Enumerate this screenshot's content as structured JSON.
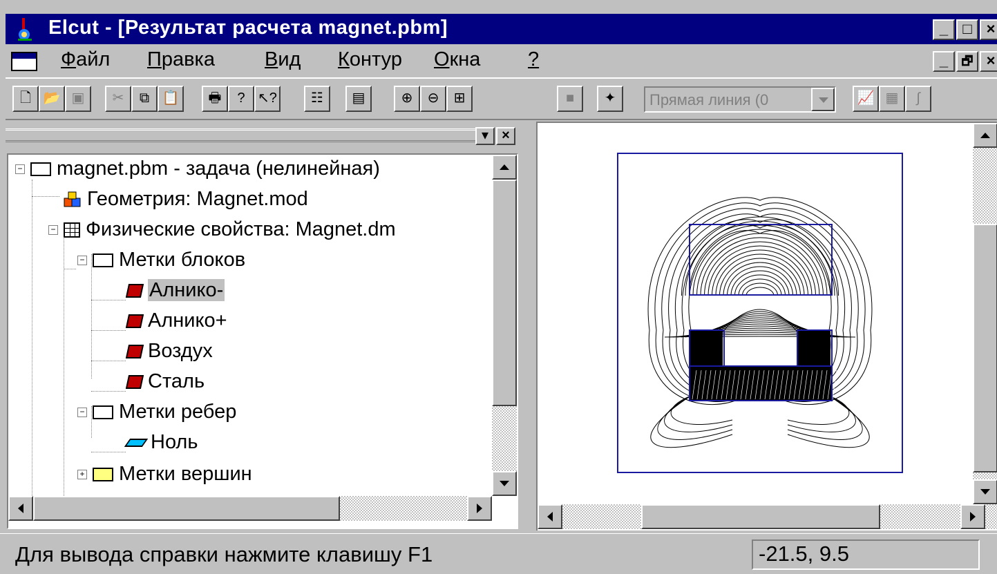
{
  "window": {
    "title": "Elcut - [Результат расчета magnet.pbm]",
    "controls": {
      "minimize": "_",
      "maximize": "□",
      "close": "×"
    }
  },
  "menu": {
    "items": [
      {
        "label": "Файл",
        "accel": "Ф",
        "rest": "айл"
      },
      {
        "label": "Правка",
        "accel": "П",
        "rest": "равка"
      },
      {
        "label": "Вид",
        "accel": "В",
        "rest": "ид"
      },
      {
        "label": "Контур",
        "accel": "К",
        "rest": "онтур"
      },
      {
        "label": "Окна",
        "accel": "О",
        "rest": "кна"
      },
      {
        "label": "?",
        "accel": "?",
        "rest": ""
      }
    ],
    "child_controls": {
      "minimize": "_",
      "restore": "🗗",
      "close": "×"
    }
  },
  "toolbar": {
    "buttons": [
      "new-icon",
      "open-icon",
      "save-icon",
      "cut-icon",
      "copy-icon",
      "paste-icon",
      "print-icon",
      "help-icon",
      "context-help-icon",
      "hierarchy-icon",
      "picture-icon",
      "zoom-in-icon",
      "zoom-out-icon",
      "zoom-fit-icon",
      "stop-icon",
      "new-contour-icon",
      "plot-icon",
      "table-icon",
      "integral-icon"
    ],
    "contour_select": {
      "value": "Прямая линия (0"
    }
  },
  "tree": {
    "nodes": [
      {
        "label": "magnet.pbm -  задача (нелинейная)",
        "icon": "folder-open-icon"
      },
      {
        "label": "Геометрия: Magnet.mod",
        "icon": "geometry-icon"
      },
      {
        "label": "Физические свойства: Magnet.dm",
        "icon": "table-grid-icon"
      },
      {
        "label": "Метки блоков",
        "icon": "folder-open-icon"
      },
      {
        "label": "Алнико-",
        "icon": "block-label-icon",
        "selected": true
      },
      {
        "label": "Алнико+",
        "icon": "block-label-icon"
      },
      {
        "label": "Воздух",
        "icon": "block-label-icon"
      },
      {
        "label": "Сталь",
        "icon": "block-label-icon"
      },
      {
        "label": "Метки ребер",
        "icon": "folder-open-icon"
      },
      {
        "label": "Ноль",
        "icon": "edge-label-icon"
      },
      {
        "label": "Метки вершин",
        "icon": "folder-icon"
      }
    ],
    "expanders": {
      "expanded": "−",
      "collapsed": "+"
    }
  },
  "status": {
    "help_text": "Для вывода справки нажмите клавишу F1",
    "coordinates": "-21.5, 9.5"
  },
  "colors": {
    "titlebar": "#000080",
    "face": "#c0c0c0",
    "plot_frame": "#1a1aa0",
    "selection": "#c0c0c0"
  }
}
